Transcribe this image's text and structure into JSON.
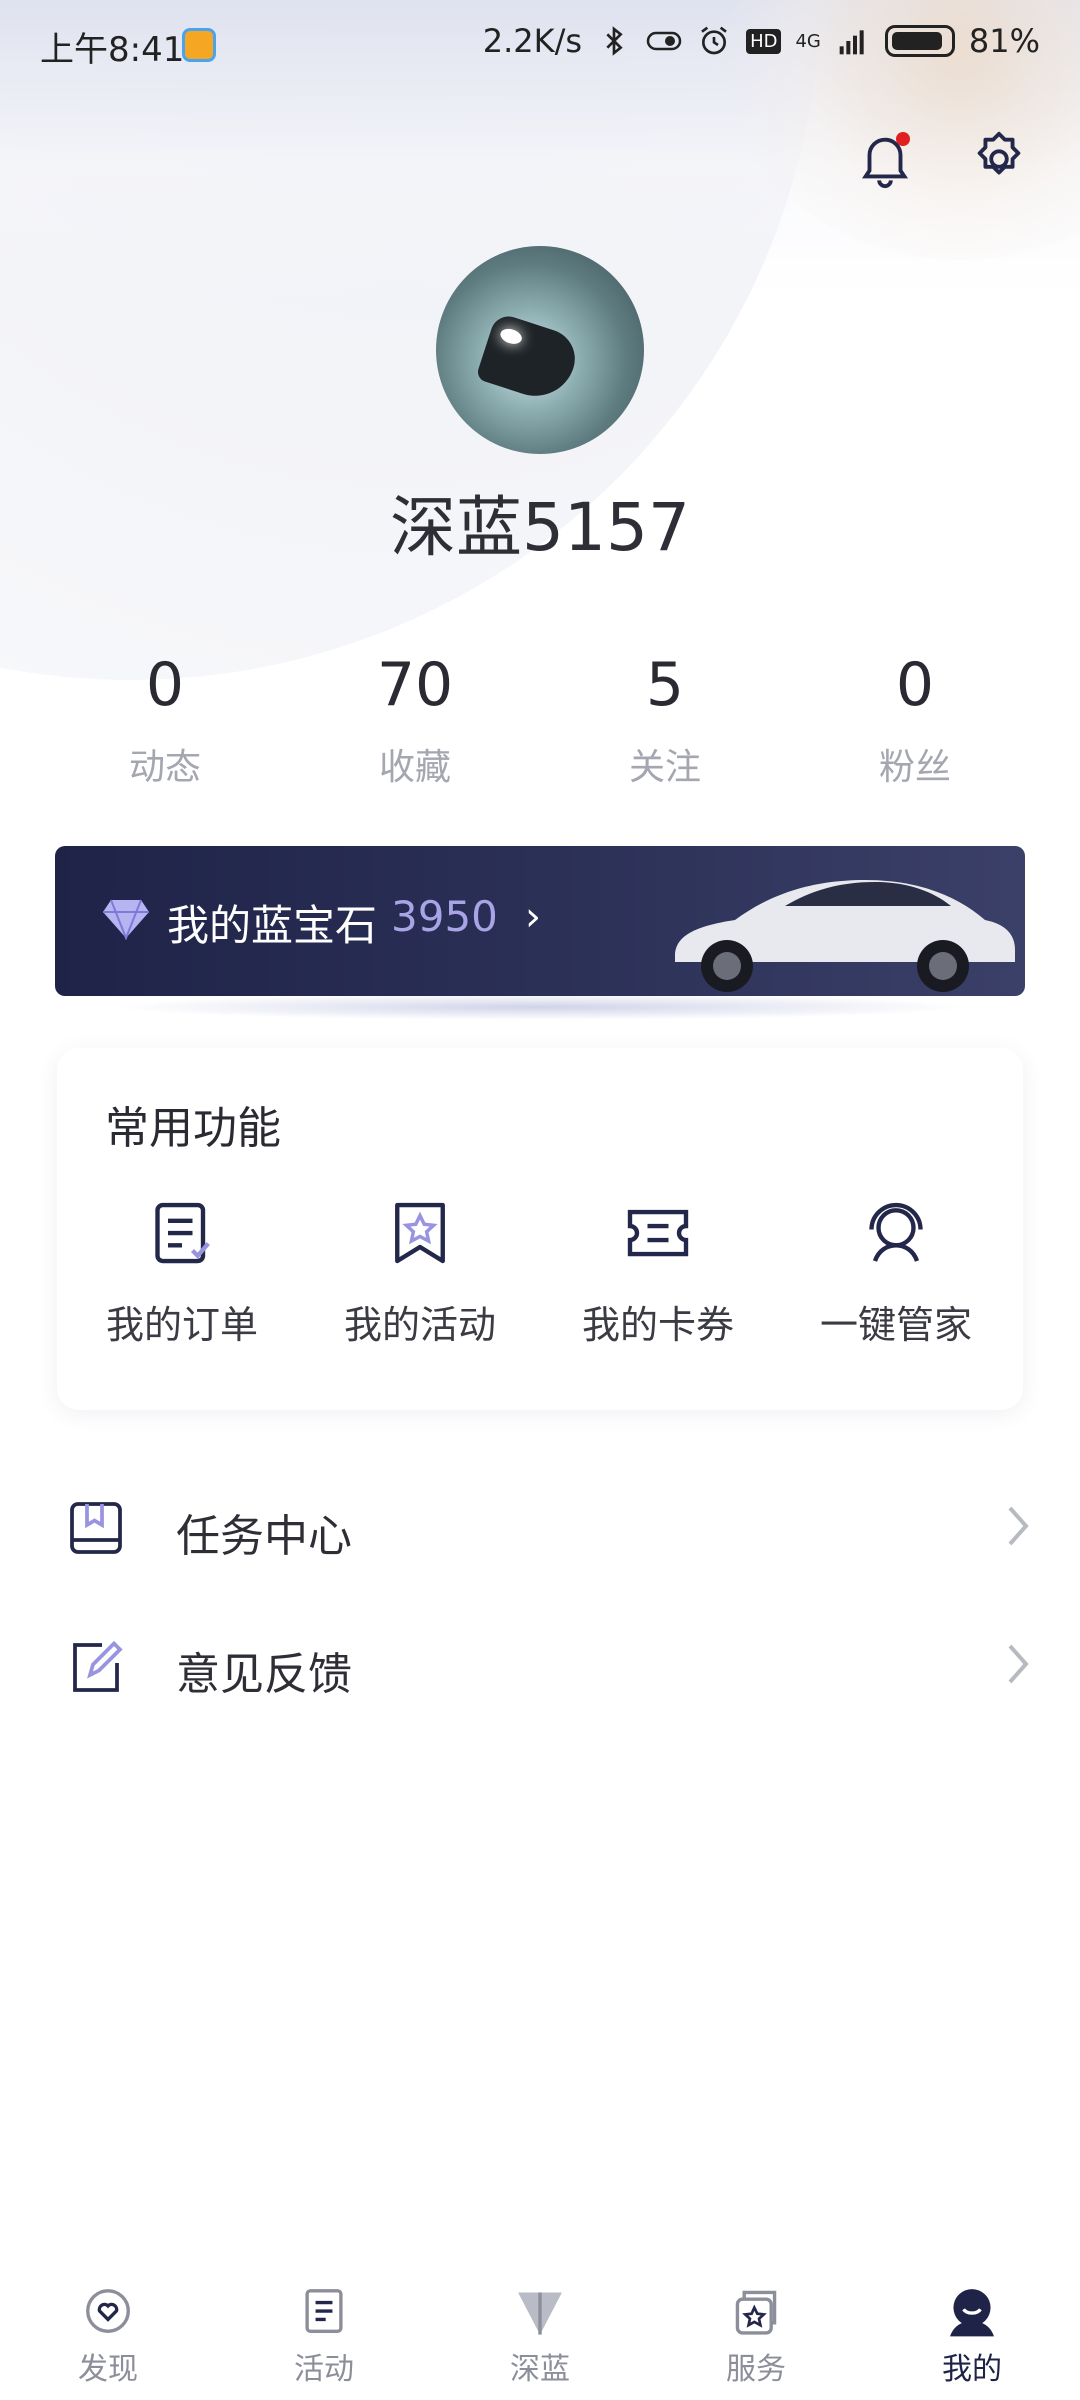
{
  "status_bar": {
    "time": "上午8:41",
    "network_speed": "2.2K/s",
    "signal_label": "4G",
    "hd_label": "HD",
    "battery": "81%"
  },
  "header": {
    "icons": [
      "bell-icon",
      "gear-icon"
    ]
  },
  "profile": {
    "username": "深蓝5157"
  },
  "stats": [
    {
      "value": "0",
      "label": "动态"
    },
    {
      "value": "70",
      "label": "收藏"
    },
    {
      "value": "5",
      "label": "关注"
    },
    {
      "value": "0",
      "label": "粉丝"
    }
  ],
  "gem_banner": {
    "label": "我的蓝宝石",
    "value": "3950",
    "chevron": "›"
  },
  "common_functions": {
    "title": "常用功能",
    "items": [
      {
        "label": "我的订单",
        "icon": "order-icon"
      },
      {
        "label": "我的活动",
        "icon": "activity-star-icon"
      },
      {
        "label": "我的卡券",
        "icon": "coupon-icon"
      },
      {
        "label": "一键管家",
        "icon": "headset-icon"
      }
    ]
  },
  "list": [
    {
      "label": "任务中心",
      "icon": "task-icon"
    },
    {
      "label": "意见反馈",
      "icon": "feedback-icon"
    }
  ],
  "tab_bar": {
    "active": "我的",
    "tabs": [
      {
        "label": "发现",
        "icon": "discover-icon"
      },
      {
        "label": "活动",
        "icon": "activity-icon"
      },
      {
        "label": "深蓝",
        "icon": "deepal-logo-icon"
      },
      {
        "label": "服务",
        "icon": "service-icon"
      },
      {
        "label": "我的",
        "icon": "profile-icon"
      }
    ]
  },
  "colors": {
    "banner_bg": "#1f2348",
    "gem_value": "#a9a4e6",
    "accent_dark": "#1f2348",
    "muted_text": "#a4a6b0"
  }
}
